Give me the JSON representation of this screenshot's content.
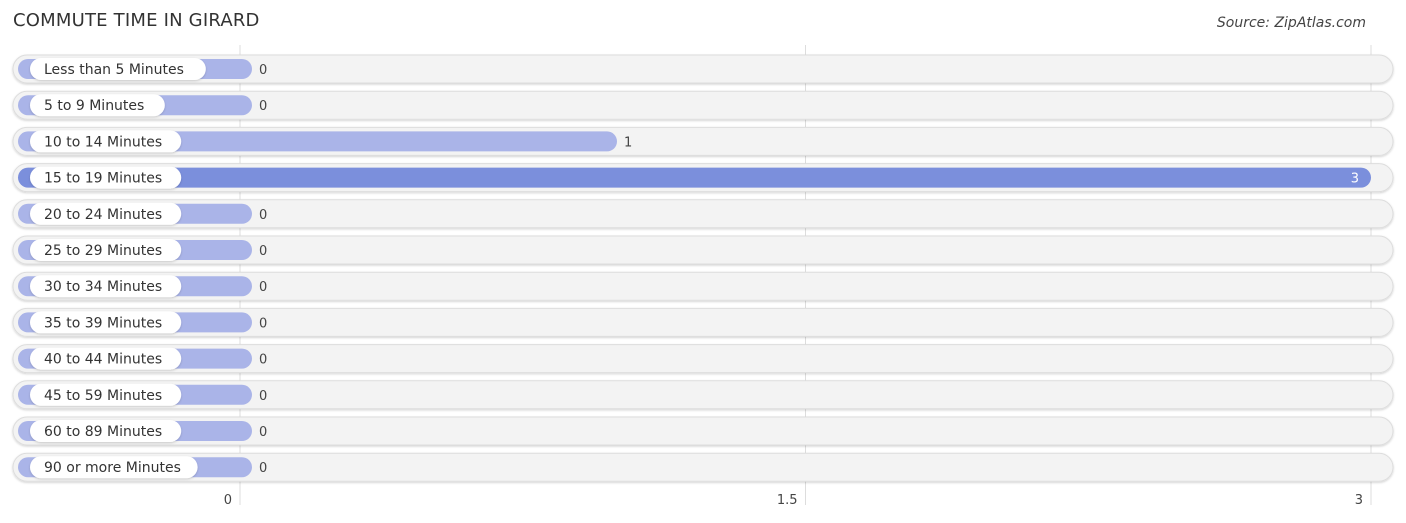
{
  "header": {
    "title": "COMMUTE TIME IN GIRARD",
    "source": "Source: ZipAtlas.com"
  },
  "colors": {
    "bar": "#aab4e8",
    "bar_highlight": "#7b8fdc",
    "track": "#f3f3f3",
    "track_border": "#dddddd",
    "grid": "#dddddd"
  },
  "chart_data": {
    "type": "bar",
    "orientation": "horizontal",
    "title": "COMMUTE TIME IN GIRARD",
    "xlabel": "",
    "ylabel": "",
    "categories": [
      "Less than 5 Minutes",
      "5 to 9 Minutes",
      "10 to 14 Minutes",
      "15 to 19 Minutes",
      "20 to 24 Minutes",
      "25 to 29 Minutes",
      "30 to 34 Minutes",
      "35 to 39 Minutes",
      "40 to 44 Minutes",
      "45 to 59 Minutes",
      "60 to 89 Minutes",
      "90 or more Minutes"
    ],
    "values": [
      0,
      0,
      1,
      3,
      0,
      0,
      0,
      0,
      0,
      0,
      0,
      0
    ],
    "xlim": [
      0,
      3
    ],
    "xticks": [
      0,
      1.5,
      3
    ],
    "xtick_labels": [
      "0",
      "1.5",
      "3"
    ],
    "grid": true,
    "highlight_index": 3
  }
}
